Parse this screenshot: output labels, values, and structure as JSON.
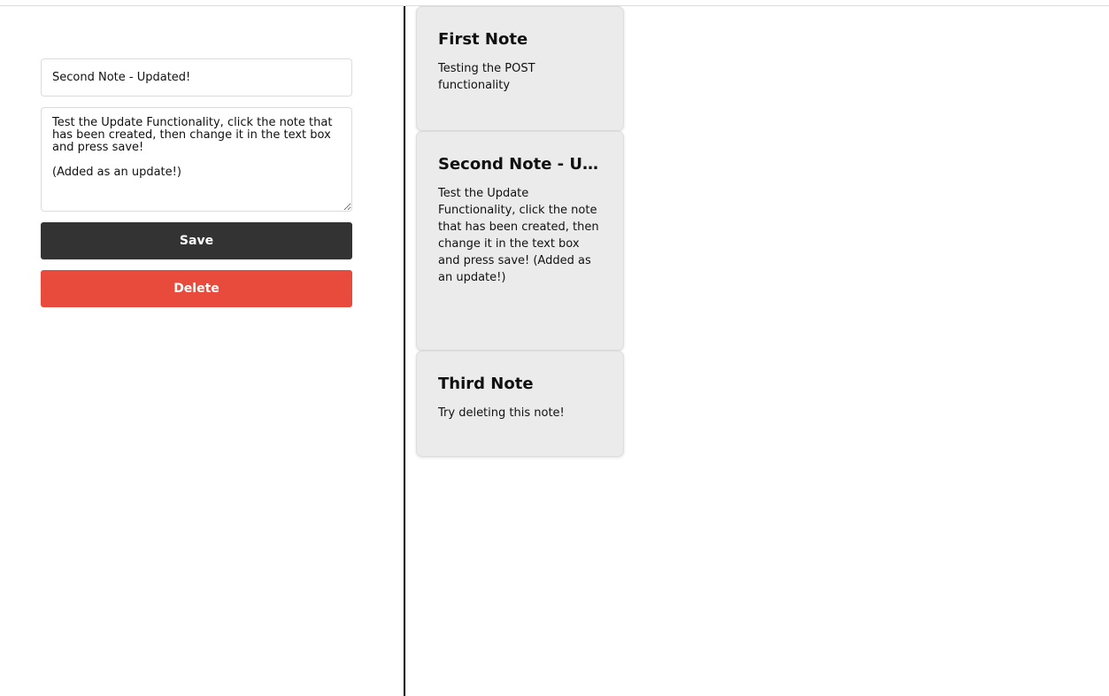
{
  "editor": {
    "title_value": "Second Note - Updated!",
    "body_value": "Test the Update Functionality, click the note that has been created, then change it in the text box and press save!\n\n(Added as an update!)",
    "save_label": "Save",
    "delete_label": "Delete"
  },
  "notes": [
    {
      "title": "First Note",
      "body": "Testing the POST functionality"
    },
    {
      "title": "Second Note - Updated!",
      "body": "Test the Update Functionality, click the note that has been created, then change it in the text box and press save! (Added as an update!)"
    },
    {
      "title": "Third Note",
      "body": "Try deleting this note!"
    }
  ],
  "colors": {
    "save_button": "#333333",
    "delete_button": "#e84b3c",
    "note_background": "#ebebeb",
    "divider": "#000000"
  }
}
